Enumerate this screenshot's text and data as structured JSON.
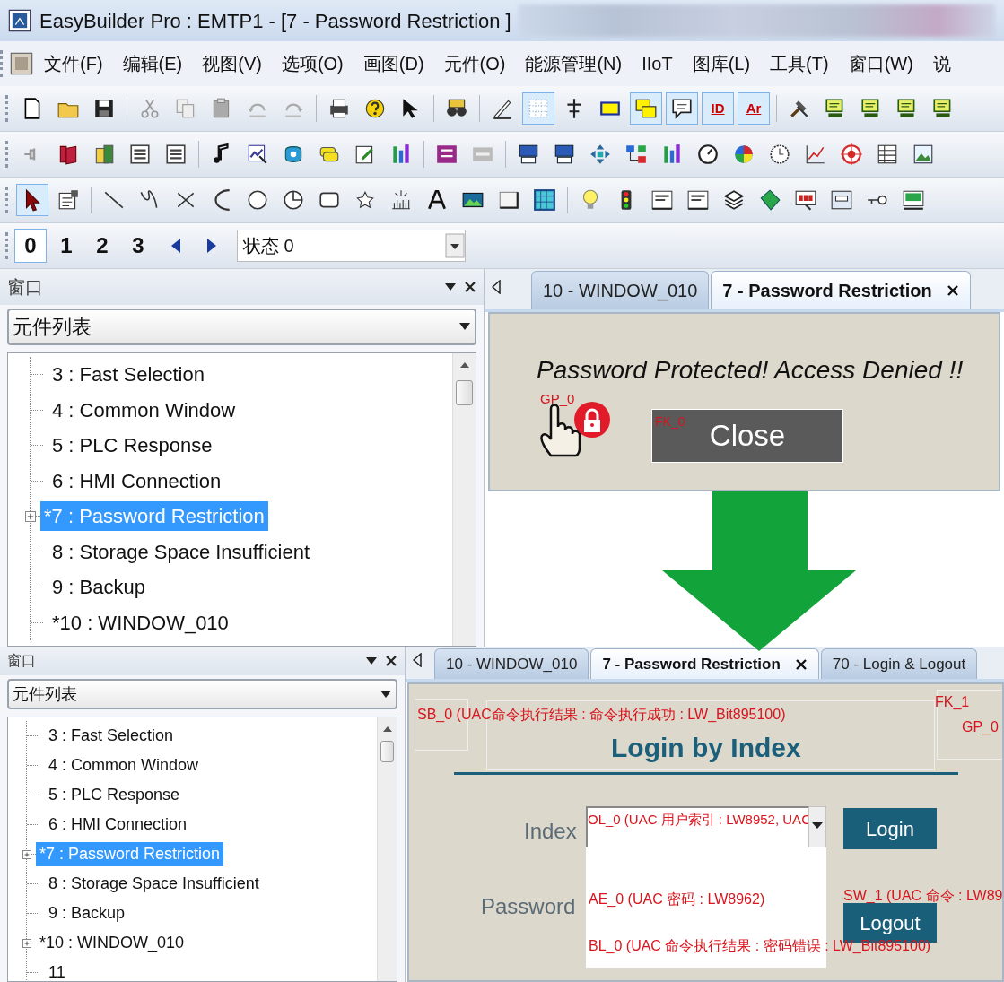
{
  "window": {
    "title": "EasyBuilder Pro : EMTP1 - [7 - Password Restriction ]"
  },
  "menu": [
    {
      "label": "文件(F)"
    },
    {
      "label": "编辑(E)"
    },
    {
      "label": "视图(V)"
    },
    {
      "label": "选项(O)"
    },
    {
      "label": "画图(D)"
    },
    {
      "label": "元件(O)"
    },
    {
      "label": "能源管理(N)"
    },
    {
      "label": "IIoT"
    },
    {
      "label": "图库(L)"
    },
    {
      "label": "工具(T)"
    },
    {
      "label": "窗口(W)"
    },
    {
      "label": "说"
    }
  ],
  "toolbars": [
    {
      "buttons": [
        {
          "selected": false
        },
        {
          "selected": false
        },
        {
          "selected": false
        },
        {
          "selected": false
        },
        {
          "selected": false
        },
        {
          "selected": false
        },
        {
          "selected": false
        },
        {
          "selected": false
        },
        {
          "selected": false
        },
        {
          "selected": false
        },
        {
          "selected": false
        },
        {
          "selected": false
        },
        {
          "selected": false
        },
        {
          "selected": true
        },
        {
          "selected": false
        },
        {
          "selected": false
        },
        {
          "selected": true
        },
        {
          "selected": true
        },
        {
          "selected": true,
          "label": "ID"
        },
        {
          "selected": true,
          "label": "Ar"
        },
        {
          "selected": false
        },
        {
          "selected": false
        },
        {
          "selected": false
        },
        {
          "selected": false
        },
        {
          "selected": false
        }
      ]
    },
    {
      "buttons": [
        {
          "selected": false
        },
        {
          "selected": false
        },
        {
          "selected": false
        },
        {
          "selected": false
        },
        {
          "selected": false
        },
        {
          "selected": false
        },
        {
          "selected": false
        },
        {
          "selected": false
        },
        {
          "selected": false
        },
        {
          "selected": false
        },
        {
          "selected": false
        },
        {
          "selected": false
        },
        {
          "selected": false
        },
        {
          "selected": false
        },
        {
          "selected": false
        },
        {
          "selected": false
        },
        {
          "selected": false
        },
        {
          "selected": false
        },
        {
          "selected": false
        },
        {
          "selected": false
        },
        {
          "selected": false
        },
        {
          "selected": false
        },
        {
          "selected": false
        },
        {
          "selected": false
        },
        {
          "selected": false
        }
      ]
    },
    {
      "buttons": [
        {
          "selected": true
        },
        {
          "selected": false
        },
        {
          "selected": false
        },
        {
          "selected": false
        },
        {
          "selected": false
        },
        {
          "selected": false
        },
        {
          "selected": false
        },
        {
          "selected": false
        },
        {
          "selected": false
        },
        {
          "selected": false
        },
        {
          "selected": false
        },
        {
          "selected": false
        },
        {
          "selected": false
        },
        {
          "selected": false
        },
        {
          "selected": false
        },
        {
          "selected": false
        },
        {
          "selected": false
        },
        {
          "selected": false
        },
        {
          "selected": false
        },
        {
          "selected": false
        },
        {
          "selected": false
        },
        {
          "selected": false
        },
        {
          "selected": false
        },
        {
          "selected": false
        },
        {
          "selected": false
        }
      ]
    }
  ],
  "state_toolbar": {
    "buttons": [
      {
        "label": "0",
        "selected": true
      },
      {
        "label": "1",
        "selected": false
      },
      {
        "label": "2",
        "selected": false
      },
      {
        "label": "3",
        "selected": false
      }
    ],
    "state": "状态 0"
  },
  "before": {
    "panel": {
      "title": "窗口",
      "view": "元件列表",
      "tree": [
        {
          "label": "3 : Fast Selection",
          "kind": "leaf",
          "selected": false
        },
        {
          "label": "4 : Common Window",
          "kind": "leaf",
          "selected": false
        },
        {
          "label": "5 : PLC Response",
          "kind": "leaf",
          "selected": false
        },
        {
          "label": "6 : HMI Connection",
          "kind": "leaf",
          "selected": false
        },
        {
          "label": "*7 : Password Restriction",
          "kind": "folder",
          "expanded": false,
          "selected": true
        },
        {
          "label": "8 : Storage Space Insufficient",
          "kind": "leaf",
          "selected": false
        },
        {
          "label": "9 : Backup",
          "kind": "leaf",
          "selected": false
        },
        {
          "label": "*10 : WINDOW_010",
          "kind": "leaf",
          "selected": false
        }
      ]
    },
    "tabs": [
      {
        "label": "10 - WINDOW_010",
        "selected": false,
        "closable": false
      },
      {
        "label": "7 - Password Restriction",
        "selected": true,
        "closable": true
      }
    ],
    "canvas": {
      "message": "Password Protected! Access Denied !!",
      "icon_tag": "GP_0",
      "button_tag": "FK_0",
      "button": "Close"
    }
  },
  "after": {
    "panel": {
      "title": "窗口",
      "view": "元件列表",
      "tree": [
        {
          "label": "3 : Fast Selection",
          "kind": "leaf",
          "selected": false
        },
        {
          "label": "4 : Common Window",
          "kind": "leaf",
          "selected": false
        },
        {
          "label": "5 : PLC Response",
          "kind": "leaf",
          "selected": false
        },
        {
          "label": "6 : HMI Connection",
          "kind": "leaf",
          "selected": false
        },
        {
          "label": "*7 : Password Restriction",
          "kind": "folder",
          "expanded": false,
          "selected": true
        },
        {
          "label": "8 : Storage Space Insufficient",
          "kind": "leaf",
          "selected": false
        },
        {
          "label": "9 : Backup",
          "kind": "leaf",
          "selected": false
        },
        {
          "label": "*10 : WINDOW_010",
          "kind": "folder",
          "expanded": false,
          "selected": false
        },
        {
          "label": "11",
          "kind": "leaf",
          "selected": false
        }
      ]
    },
    "tabs": [
      {
        "label": "10 - WINDOW_010",
        "selected": false,
        "closable": false
      },
      {
        "label": "7 - Password Restriction",
        "selected": true,
        "closable": true
      },
      {
        "label": "70 - Login & Logout",
        "selected": false,
        "closable": false
      }
    ],
    "canvas": {
      "status_tag": "SB_0 (UAC命令执行结果 : 命令执行成功 : LW_Bit895100)",
      "title": "Login by Index",
      "corner_tag": "FK_1",
      "corner_tag_2": "GP_0",
      "index_label": "Index",
      "index_field": "OL_0 (UAC 用户索引 : LW8952, UAC",
      "login": "Login",
      "password_label": "Password",
      "password_field": "AE_0 (UAC 密码 : LW8962)",
      "command_tag": "SW_1 (UAC 命令 : LW89",
      "logout": "Logout",
      "result_tag": "BL_0 (UAC 命令执行结果 : 密码错误 : LW_Bit895100)"
    }
  }
}
